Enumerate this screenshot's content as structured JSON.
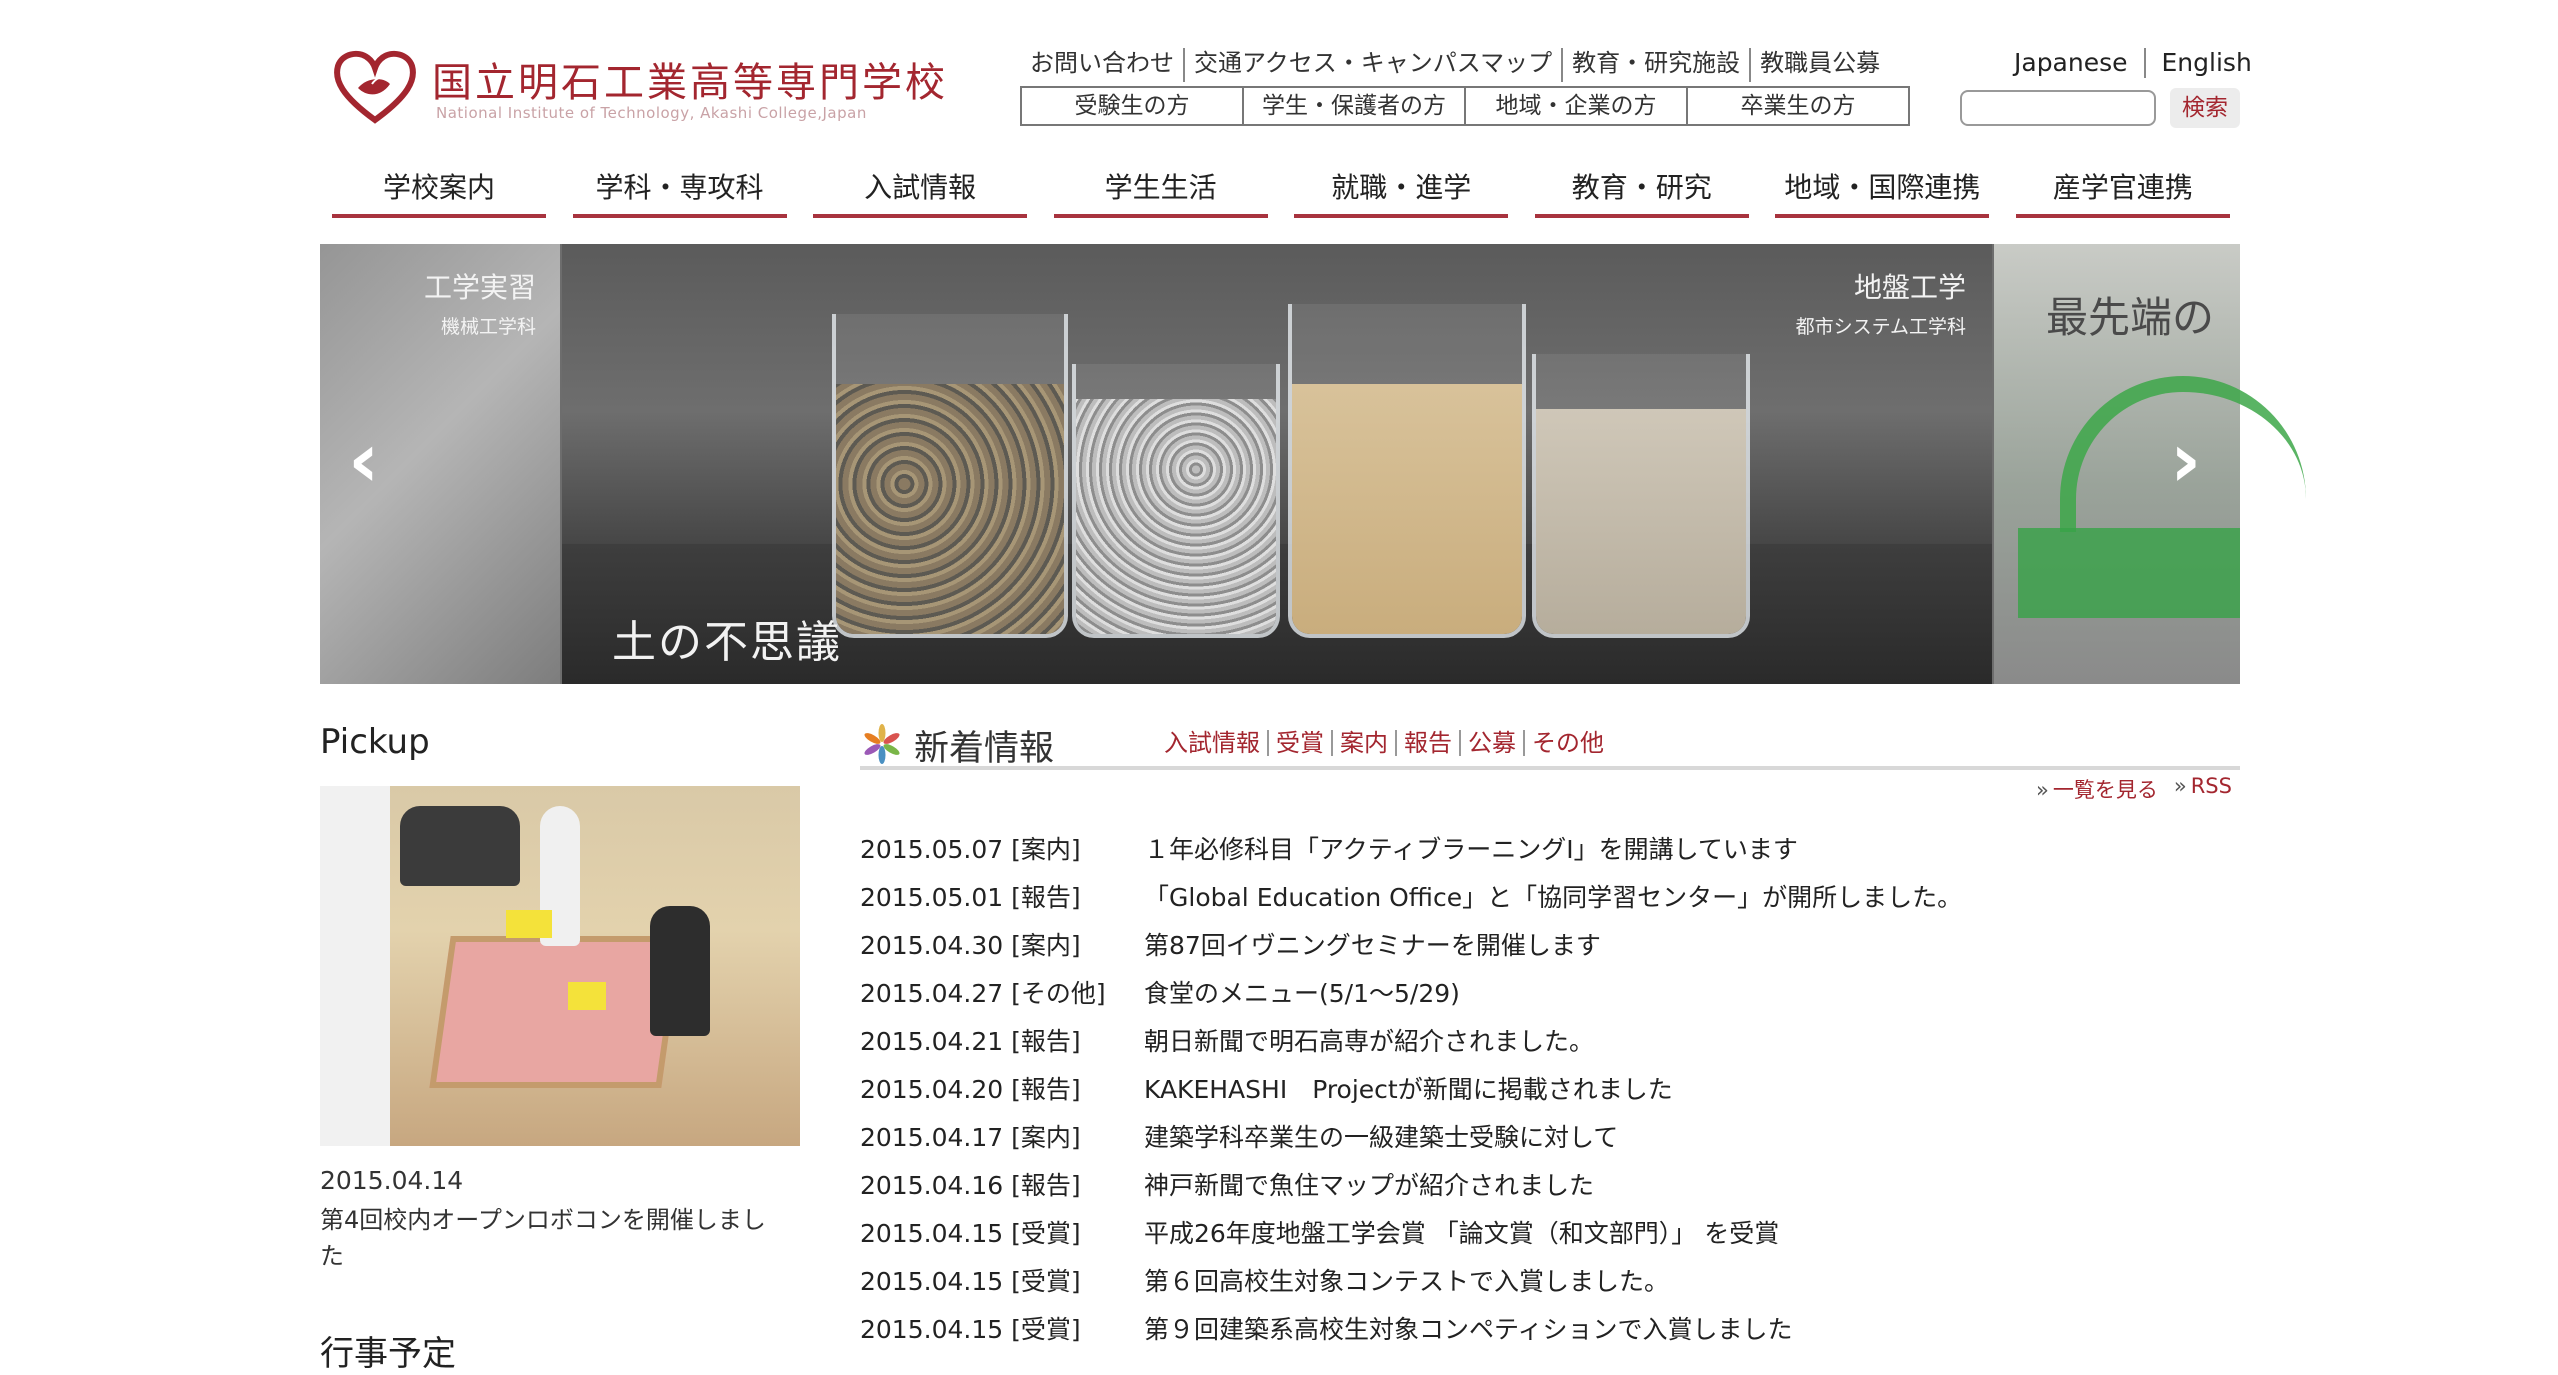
{
  "header": {
    "logo_ja": "国立明石工業高等専門学校",
    "logo_en": "National Institute of Technology, Akashi College,Japan",
    "top_links": [
      "お問い合わせ",
      "交通アクセス・キャンパスマップ",
      "教育・研究施設",
      "教職員公募"
    ],
    "audience_links": [
      "受験生の方",
      "学生・保護者の方",
      "地域・企業の方",
      "卒業生の方"
    ],
    "languages": [
      "Japanese",
      "English"
    ],
    "search": {
      "placeholder": "",
      "button": "検索"
    }
  },
  "main_nav": [
    "学校案内",
    "学科・専攻科",
    "入試情報",
    "学生生活",
    "就職・進学",
    "教育・研究",
    "地域・国際連携",
    "産学官連携"
  ],
  "slider": {
    "left": {
      "title": "工学実習",
      "subtitle": "機械工学科"
    },
    "main": {
      "title": "地盤工学",
      "subtitle": "都市システム工学科",
      "headline": "土の不思議"
    },
    "right": {
      "title": "最先端の"
    },
    "prev_arrow": "‹",
    "next_arrow": "›"
  },
  "pickup": {
    "heading": "Pickup",
    "date": "2015.04.14",
    "text": "第4回校内オープンロボコンを開催しました"
  },
  "schedule": {
    "heading": "行事予定"
  },
  "news": {
    "heading": "新着情報",
    "categories": [
      "入試情報",
      "受賞",
      "案内",
      "報告",
      "公募",
      "その他"
    ],
    "view_all": "一覧を見る",
    "rss": "RSS",
    "items": [
      {
        "date": "2015.05.07",
        "tag": "[案内]",
        "title": "１年必修科目「アクティブラーニングⅠ」を開講しています"
      },
      {
        "date": "2015.05.01",
        "tag": "[報告]",
        "title": "「Global Education Office」と「協同学習センター」が開所しました。"
      },
      {
        "date": "2015.04.30",
        "tag": "[案内]",
        "title": "第87回イヴニングセミナーを開催します"
      },
      {
        "date": "2015.04.27",
        "tag": "[その他]",
        "title": "食堂のメニュー(5/1～5/29)"
      },
      {
        "date": "2015.04.21",
        "tag": "[報告]",
        "title": "朝日新聞で明石高専が紹介されました。"
      },
      {
        "date": "2015.04.20",
        "tag": "[報告]",
        "title": "KAKEHASHI　Projectが新聞に掲載されました"
      },
      {
        "date": "2015.04.17",
        "tag": "[案内]",
        "title": "建築学科卒業生の一級建築士受験に対して"
      },
      {
        "date": "2015.04.16",
        "tag": "[報告]",
        "title": "神戸新聞で魚住マップが紹介されました"
      },
      {
        "date": "2015.04.15",
        "tag": "[受賞]",
        "title": "平成26年度地盤工学会賞 「論文賞（和文部門）」 を受賞"
      },
      {
        "date": "2015.04.15",
        "tag": "[受賞]",
        "title": "第６回高校生対象コンテストで入賞しました。"
      },
      {
        "date": "2015.04.15",
        "tag": "[受賞]",
        "title": "第９回建築系高校生対象コンペティションで入賞しました"
      }
    ]
  },
  "colors": {
    "accent": "#a3262f",
    "nav_underline": "#a8333e"
  }
}
